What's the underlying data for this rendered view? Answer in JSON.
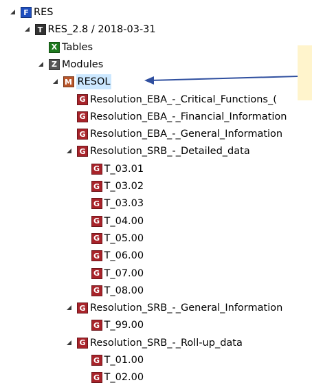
{
  "tree": {
    "nodes": [
      {
        "label": "RES",
        "icon": "F",
        "icon_name": "framework-icon",
        "icon_color": "#1f4fbf",
        "depth": 0,
        "state": "expanded"
      },
      {
        "label": "RES_2.8 / 2018-03-31",
        "icon": "T",
        "icon_name": "taxonomy-icon",
        "icon_color": "#333333",
        "depth": 1,
        "state": "expanded"
      },
      {
        "label": "Tables",
        "icon": "X",
        "icon_name": "tables-icon",
        "icon_color": "#1e7a1e",
        "depth": 2,
        "state": "collapsed"
      },
      {
        "label": "Modules",
        "icon": "Z",
        "icon_name": "modules-icon",
        "icon_color": "#555555",
        "depth": 2,
        "state": "expanded"
      },
      {
        "label": "RESOL",
        "icon": "M",
        "icon_name": "module-icon",
        "icon_color": "#b9562a",
        "depth": 3,
        "state": "expanded",
        "selected": true
      },
      {
        "label": "Resolution_EBA_-_Critical_Functions_(",
        "icon": "G",
        "icon_name": "group-icon",
        "icon_color": "#a8232a",
        "depth": 4,
        "state": "collapsed"
      },
      {
        "label": "Resolution_EBA_-_Financial_Information",
        "icon": "G",
        "icon_name": "group-icon",
        "icon_color": "#a8232a",
        "depth": 4,
        "state": "collapsed"
      },
      {
        "label": "Resolution_EBA_-_General_Information",
        "icon": "G",
        "icon_name": "group-icon",
        "icon_color": "#a8232a",
        "depth": 4,
        "state": "collapsed"
      },
      {
        "label": "Resolution_SRB_-_Detailed_data",
        "icon": "G",
        "icon_name": "group-icon",
        "icon_color": "#a8232a",
        "depth": 4,
        "state": "expanded"
      },
      {
        "label": "T_03.01",
        "icon": "G",
        "icon_name": "group-icon",
        "icon_color": "#a8232a",
        "depth": 5,
        "state": "collapsed"
      },
      {
        "label": "T_03.02",
        "icon": "G",
        "icon_name": "group-icon",
        "icon_color": "#a8232a",
        "depth": 5,
        "state": "collapsed"
      },
      {
        "label": "T_03.03",
        "icon": "G",
        "icon_name": "group-icon",
        "icon_color": "#a8232a",
        "depth": 5,
        "state": "collapsed"
      },
      {
        "label": "T_04.00",
        "icon": "G",
        "icon_name": "group-icon",
        "icon_color": "#a8232a",
        "depth": 5,
        "state": "collapsed"
      },
      {
        "label": "T_05.00",
        "icon": "G",
        "icon_name": "group-icon",
        "icon_color": "#a8232a",
        "depth": 5,
        "state": "collapsed"
      },
      {
        "label": "T_06.00",
        "icon": "G",
        "icon_name": "group-icon",
        "icon_color": "#a8232a",
        "depth": 5,
        "state": "collapsed"
      },
      {
        "label": "T_07.00",
        "icon": "G",
        "icon_name": "group-icon",
        "icon_color": "#a8232a",
        "depth": 5,
        "state": "collapsed"
      },
      {
        "label": "T_08.00",
        "icon": "G",
        "icon_name": "group-icon",
        "icon_color": "#a8232a",
        "depth": 5,
        "state": "collapsed"
      },
      {
        "label": "Resolution_SRB_-_General_Information",
        "icon": "G",
        "icon_name": "group-icon",
        "icon_color": "#a8232a",
        "depth": 4,
        "state": "expanded"
      },
      {
        "label": "T_99.00",
        "icon": "G",
        "icon_name": "group-icon",
        "icon_color": "#a8232a",
        "depth": 5,
        "state": "collapsed"
      },
      {
        "label": "Resolution_SRB_-_Roll-up_data",
        "icon": "G",
        "icon_name": "group-icon",
        "icon_color": "#a8232a",
        "depth": 4,
        "state": "expanded"
      },
      {
        "label": "T_01.00",
        "icon": "G",
        "icon_name": "group-icon",
        "icon_color": "#a8232a",
        "depth": 5,
        "state": "collapsed"
      },
      {
        "label": "T_02.00",
        "icon": "G",
        "icon_name": "group-icon",
        "icon_color": "#a8232a",
        "depth": 5,
        "state": "collapsed"
      }
    ]
  },
  "annotation": {
    "arrow_color": "#2f4f9f",
    "note_color": "#fff4cc"
  }
}
